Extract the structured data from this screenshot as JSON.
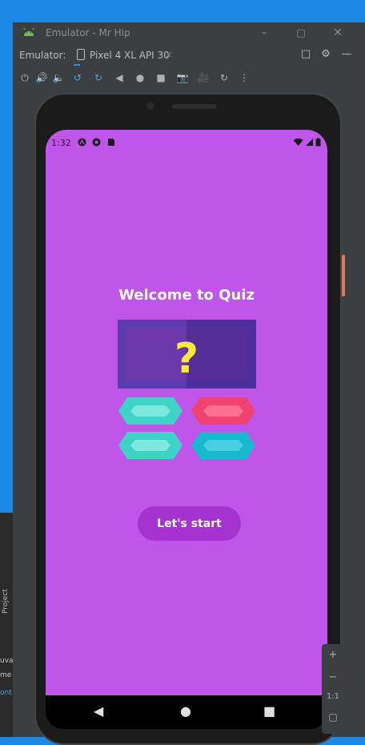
{
  "window": {
    "title": "Emulator - Mr Hip",
    "emulator_label": "Emulator:",
    "device_tab": "Pixel 4 XL API 30"
  },
  "phone": {
    "status_time": "1:32",
    "welcome_text": "Welcome to Quiz",
    "start_button": "Let's start"
  },
  "zoom": {
    "plus": "+",
    "minus": "−",
    "ratio": "1:1"
  },
  "ide": {
    "project_tab": "Project",
    "frag1": "uva",
    "frag2": "me",
    "frag3": "ont"
  },
  "colors": {
    "screen_bg": "#c055ea",
    "button_bg": "#a533cf",
    "card_bg": "#5b3bb0",
    "answer_teal": "#3fd3c8",
    "answer_pink": "#f0426e",
    "answer_cyan": "#1ab8cf"
  }
}
